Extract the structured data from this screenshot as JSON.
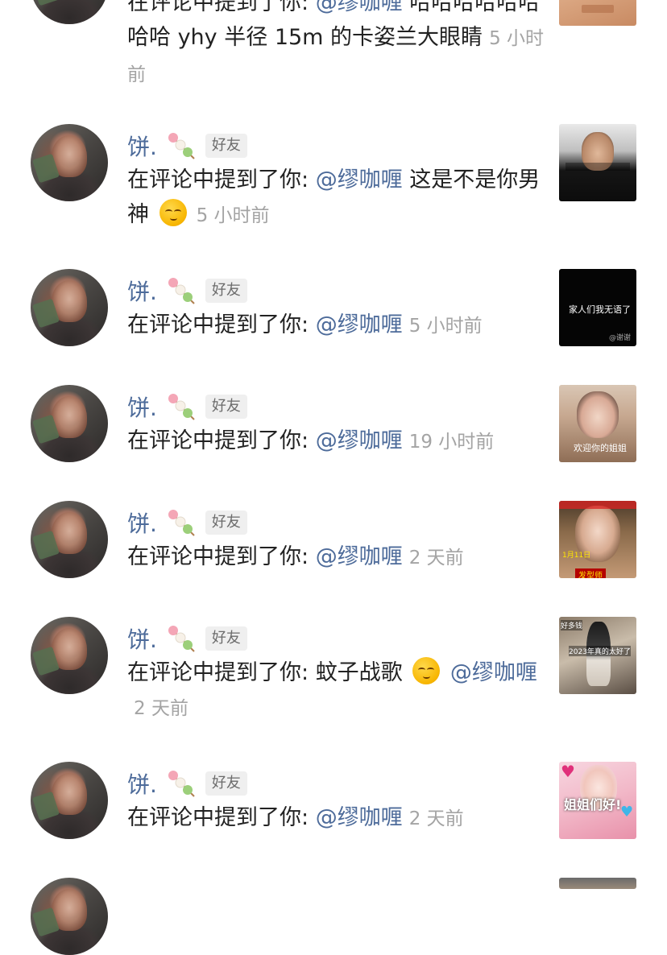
{
  "notifications": [
    {
      "name": "",
      "badge": "",
      "action": "在评论中提到了你: ",
      "segments": [
        {
          "text": "@缪咖喱",
          "type": "mention"
        },
        {
          "text": " 哈哈哈哈哈哈哈哈 yhy 半径 15m 的卡姿兰大眼睛",
          "type": "text"
        }
      ],
      "time": "5 小时前"
    },
    {
      "name": "饼.",
      "badge": "好友",
      "action": "在评论中提到了你: ",
      "segments": [
        {
          "text": "@缪咖喱",
          "type": "mention"
        },
        {
          "text": " 这是不是你男神",
          "type": "text"
        },
        {
          "text": "relieved-face-emoji",
          "type": "emoji"
        }
      ],
      "time": "5 小时前"
    },
    {
      "name": "饼.",
      "badge": "好友",
      "action": "在评论中提到了你: ",
      "segments": [
        {
          "text": "@缪咖喱",
          "type": "mention"
        }
      ],
      "time": "5 小时前",
      "thumb_text": [
        "家人们我无语了",
        "@谢谢"
      ]
    },
    {
      "name": "饼.",
      "badge": "好友",
      "action": "在评论中提到了你: ",
      "segments": [
        {
          "text": "@缪咖喱",
          "type": "mention"
        }
      ],
      "time": "19 小时前",
      "thumb_text": [
        "欢迎你的姐姐"
      ]
    },
    {
      "name": "饼.",
      "badge": "好友",
      "action": "在评论中提到了你: ",
      "segments": [
        {
          "text": "@缪咖喱",
          "type": "mention"
        }
      ],
      "time": "2 天前",
      "thumb_text": [
        "1月11日",
        "发型师"
      ]
    },
    {
      "name": "饼.",
      "badge": "好友",
      "action": "在评论中提到了你: ",
      "segments": [
        {
          "text": "蚊子战歌",
          "type": "text"
        },
        {
          "text": "relieved-face-emoji",
          "type": "emoji"
        },
        {
          "text": " @缪咖喱",
          "type": "mention"
        }
      ],
      "time": "2 天前",
      "thumb_text": [
        "好多钱",
        "2023年真的太好了"
      ]
    },
    {
      "name": "饼.",
      "badge": "好友",
      "action": "在评论中提到了你: ",
      "segments": [
        {
          "text": "@缪咖喱",
          "type": "mention"
        }
      ],
      "time": "2 天前",
      "thumb_text": [
        "姐姐们好!"
      ]
    }
  ],
  "colors": {
    "name": "#4d6b9a",
    "mention": "#4d6b9a",
    "time": "#a4a4a4",
    "badge_bg": "#efefef"
  }
}
